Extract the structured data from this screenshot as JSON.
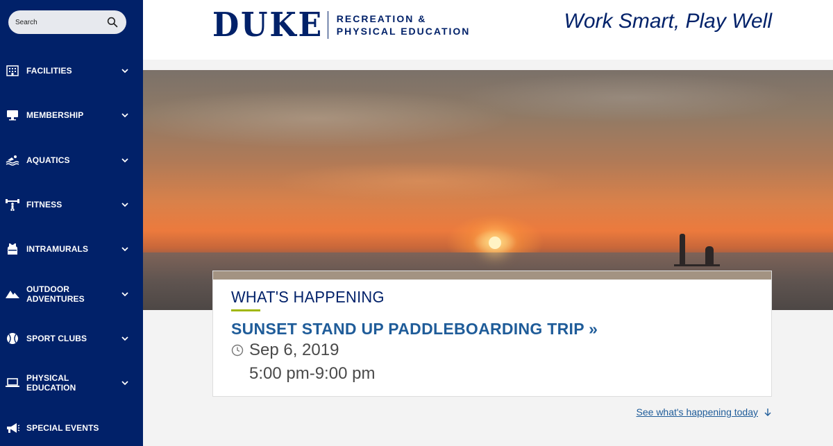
{
  "search": {
    "placeholder": "Search"
  },
  "sidebar": {
    "items": [
      {
        "label": "FACILITIES",
        "icon": "building-icon"
      },
      {
        "label": "MEMBERSHIP",
        "icon": "membership-card-icon"
      },
      {
        "label": "AQUATICS",
        "icon": "swimmer-icon"
      },
      {
        "label": "FITNESS",
        "icon": "weightlifter-icon"
      },
      {
        "label": "INTRAMURALS",
        "icon": "jersey-icon"
      },
      {
        "label": "OUTDOOR ADVENTURES",
        "icon": "mountain-icon"
      },
      {
        "label": "SPORT CLUBS",
        "icon": "ball-icon"
      },
      {
        "label": "PHYSICAL EDUCATION",
        "icon": "laptop-icon"
      },
      {
        "label": "SPECIAL EVENTS",
        "icon": "megaphone-icon"
      }
    ]
  },
  "header": {
    "logo_word": "DUKE",
    "logo_sub_line1": "RECREATION &",
    "logo_sub_line2": "PHYSICAL EDUCATION",
    "tagline": "Work Smart, Play Well"
  },
  "event": {
    "kicker": "WHAT'S HAPPENING",
    "title": "SUNSET STAND UP PADDLEBOARDING TRIP »",
    "date": "Sep 6, 2019",
    "time": "5:00 pm-9:00 pm"
  },
  "today_link": "See what's happening today",
  "colors": {
    "navy": "#012169",
    "link_blue": "#1f5c99",
    "accent_green": "#a1b70d"
  }
}
